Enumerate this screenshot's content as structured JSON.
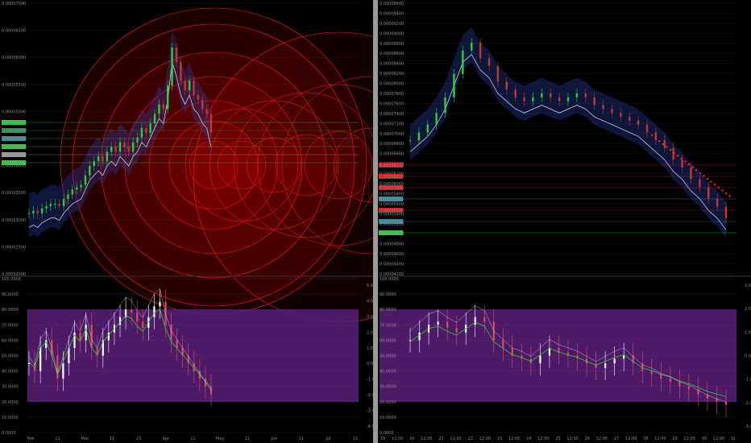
{
  "colors": {
    "background": "#000000",
    "candle_green": "#2ecc40",
    "candle_red": "#c0392b",
    "fib_circles": "#ff1a1a",
    "oscillator_band": "#5a1f7a",
    "ribbon": "#2a3fa8"
  },
  "chart_data": [
    {
      "type": "candlestick",
      "panel": "left-main",
      "y_axis_labels": [
        "0.00007000",
        "0.00006500",
        "0.00006000",
        "0.00005500",
        "0.00005000",
        "0.00004500",
        "0.00004000",
        "0.00003500",
        "0.00003000",
        "0.00002500",
        "0.00002000"
      ],
      "x_axis_labels": [
        "Feb",
        "11",
        "Mar",
        "11",
        "21",
        "Apr",
        "11",
        "May",
        "11",
        "Jun",
        "11",
        "Jul",
        "11"
      ],
      "price_tags": [
        "0.00004620",
        "0.00004750",
        "0.00004340",
        "0.00004200",
        "0.00004100",
        "0.00004000"
      ],
      "close_series": [
        2.8,
        2.85,
        2.8,
        2.9,
        2.95,
        3.0,
        3.0,
        2.95,
        3.1,
        3.2,
        3.3,
        3.35,
        3.4,
        3.6,
        3.8,
        3.9,
        4.0,
        3.9,
        4.1,
        4.2,
        4.1,
        4.3,
        4.2,
        4.1,
        4.3,
        4.4,
        4.6,
        4.5,
        4.7,
        4.9,
        5.1,
        5.0,
        5.5,
        6.3,
        6.0,
        5.6,
        5.4,
        5.6,
        5.3,
        5.2,
        5.0,
        4.9,
        4.5
      ],
      "overlay": "fibonacci circles"
    },
    {
      "type": "oscillator",
      "panel": "left-sub",
      "y_axis_labels": [
        "100.0000",
        "90.0000",
        "80.0000",
        "70.0000",
        "60.0000",
        "50.0000",
        "40.0000",
        "30.0000",
        "20.0000",
        "10.0000",
        "0.0000"
      ],
      "right_axis_labels": [
        "5.0",
        "4.0",
        "3.0",
        "2.0",
        "1.0",
        "0.0",
        "-1.0",
        "-2.0",
        "-3.0",
        "-4.0"
      ],
      "band": [
        20,
        80
      ],
      "bars": [
        45,
        40,
        55,
        60,
        50,
        35,
        45,
        55,
        65,
        60,
        70,
        55,
        50,
        60,
        65,
        70,
        75,
        80,
        78,
        72,
        68,
        75,
        82,
        85,
        70,
        60,
        55,
        50,
        45,
        40,
        35,
        30,
        25
      ],
      "x_axis_labels": [
        "Feb",
        "11",
        "Mar",
        "11",
        "21",
        "Apr",
        "11",
        "May",
        "11",
        "Jun",
        "11",
        "Jul",
        "11"
      ]
    },
    {
      "type": "candlestick",
      "panel": "right-main",
      "y_axis_labels": [
        "0.00009600",
        "0.00009400",
        "0.00009200",
        "0.00009000",
        "0.00008800",
        "0.00008600",
        "0.00008400",
        "0.00008200",
        "0.00008000",
        "0.00007800",
        "0.00007600",
        "0.00007400",
        "0.00007200",
        "0.00007000",
        "0.00006800",
        "0.00006600",
        "0.00006400",
        "0.00006200",
        "0.00006000",
        "0.00005800",
        "0.00005600",
        "0.00005400",
        "0.00005200",
        "0.00005000",
        "0.00004800",
        "0.00004600",
        "0.00004400",
        "0.00004200"
      ],
      "x_axis_labels": [
        "19",
        "12:00",
        "20",
        "12:00",
        "21",
        "12:00",
        "22",
        "12:00",
        "23",
        "12:00",
        "24",
        "12:00",
        "25",
        "12:00",
        "26",
        "12:00",
        "27",
        "12:00",
        "28",
        "12:00",
        "29",
        "12:00",
        "30",
        "12:00",
        "31"
      ],
      "price_tags": [
        "0.00006310",
        "0.00006100",
        "0.00005900",
        "0.00005500",
        "0.00005300",
        "0.00005100",
        "0.00004960"
      ],
      "close_series": [
        6.5,
        6.7,
        6.9,
        7.2,
        7.6,
        8.2,
        8.8,
        9.0,
        8.6,
        8.4,
        8.0,
        7.8,
        7.6,
        7.5,
        7.6,
        7.7,
        7.6,
        7.5,
        7.6,
        7.7,
        7.6,
        7.4,
        7.3,
        7.2,
        7.1,
        7.0,
        6.9,
        6.7,
        6.5,
        6.3,
        6.0,
        5.8,
        5.5,
        5.3,
        5.0,
        4.8,
        4.5
      ]
    },
    {
      "type": "oscillator",
      "panel": "right-sub",
      "y_axis_labels": [
        "100.0000",
        "90.0000",
        "80.0000",
        "70.0000",
        "60.0000",
        "50.0000",
        "40.0000",
        "30.0000",
        "20.0000",
        "10.0000",
        "0.0000"
      ],
      "right_axis_labels": [
        "3.0",
        "2.0",
        "1.0",
        "0.0",
        "-1.0",
        "-2.0",
        "-3.0"
      ],
      "band": [
        20,
        80
      ],
      "bars": [
        60,
        65,
        70,
        72,
        68,
        65,
        70,
        75,
        72,
        60,
        55,
        50,
        48,
        45,
        50,
        55,
        52,
        50,
        48,
        45,
        42,
        45,
        48,
        50,
        45,
        40,
        38,
        35,
        33,
        30,
        28,
        25,
        22,
        20,
        18
      ],
      "x_axis_labels": [
        "19",
        "20",
        "21",
        "22",
        "23",
        "24",
        "25",
        "26",
        "27",
        "28",
        "29",
        "30",
        "31"
      ]
    }
  ]
}
